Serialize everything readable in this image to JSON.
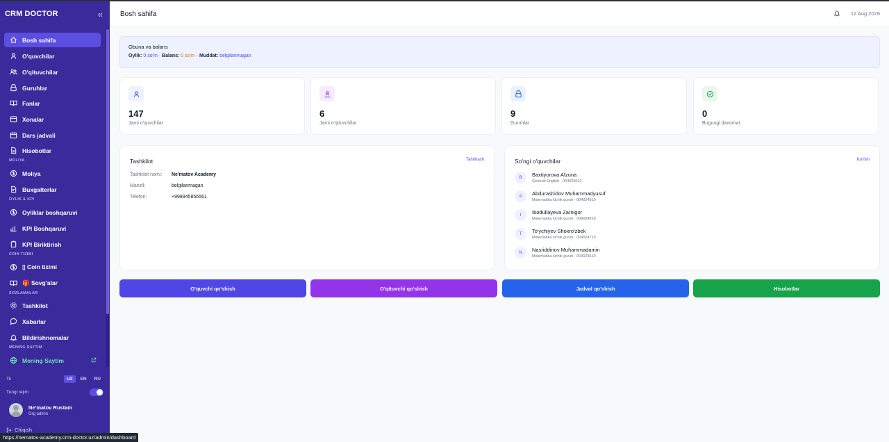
{
  "app": {
    "brand": "CRM DOCTOR"
  },
  "sidebar": {
    "items": [
      {
        "label": "Bosh sahifa",
        "icon": "home-icon"
      },
      {
        "label": "O'quvchilar",
        "icon": "users-icon"
      },
      {
        "label": "O'qituvchilar",
        "icon": "teachers-icon"
      },
      {
        "label": "Guruhlar",
        "icon": "group-icon"
      },
      {
        "label": "Fanlar",
        "icon": "book-icon"
      },
      {
        "label": "Xonalar",
        "icon": "room-icon"
      },
      {
        "label": "Dars jadvali",
        "icon": "calendar-icon"
      },
      {
        "label": "Hisobotlar",
        "icon": "report-icon"
      },
      {
        "label": "Moliya",
        "icon": "dollar-icon"
      },
      {
        "label": "Buxgalterlar",
        "icon": "accountant-icon"
      },
      {
        "label": "Oyliklar boshqaruvi",
        "icon": "dollar-icon"
      },
      {
        "label": "KPI Boshqaruvi",
        "icon": "chart-icon"
      },
      {
        "label": "KPI Biriktirish",
        "icon": "clipboard-icon"
      },
      {
        "label": "▯ Coin tizimi",
        "icon": "coin-icon"
      },
      {
        "label": "🎁 Sovg'alar",
        "icon": "gift-book-icon"
      },
      {
        "label": "Tashkilot",
        "icon": "settings-icon"
      },
      {
        "label": "Xabarlar",
        "icon": "message-icon"
      },
      {
        "label": "Bildirishnomalar",
        "icon": "bell-icon"
      },
      {
        "label": "Mening Saytim",
        "icon": "globe-icon"
      }
    ],
    "sections": [
      "MOLIYA",
      "OYLIK & KPI",
      "COIN TIZIMI",
      "SOZLAMALAR",
      "MENING SAYTIM"
    ],
    "lang_label": "Til",
    "langs": [
      "UZ",
      "EN",
      "RU"
    ],
    "theme_label": "Tungi rejim",
    "user_name": "Ne'matov Rustam",
    "user_role": "Org admin",
    "logout": "Chiqish"
  },
  "header": {
    "title": "Bosh sahifa",
    "date": "12 Aug 2026"
  },
  "subscription": {
    "title": "Obuna va balans",
    "monthly_label": "Oylik:",
    "monthly_value": "0 so'm",
    "sep1": " · ",
    "balance_label": "Balans:",
    "balance_value": "0 so'm",
    "sep2": " · ",
    "term_label": "Muddat:",
    "term_value": "belgilanmagan"
  },
  "stats": [
    {
      "value": "147",
      "label": "Jami o'quvchilar",
      "color": "#4f46e5",
      "bg": "#eef2ff",
      "icon": "users-icon"
    },
    {
      "value": "6",
      "label": "Jami o'qituvchilar",
      "color": "#9333ea",
      "bg": "#f5ecfe",
      "icon": "teachers-icon"
    },
    {
      "value": "9",
      "label": "Guruhlar",
      "color": "#2563eb",
      "bg": "#eaf1fe",
      "icon": "group-icon"
    },
    {
      "value": "0",
      "label": "Bugungi davomat",
      "color": "#16a34a",
      "bg": "#e8f8ee",
      "icon": "check-icon"
    }
  ],
  "org": {
    "title": "Tashkilot",
    "edit": "Tahrirlash",
    "rows": [
      {
        "k": "Tashkilot nomi:",
        "v": "Ne'matov Academy"
      },
      {
        "k": "Manzil:",
        "v": "belgilanmagan"
      },
      {
        "k": "Telefon:",
        "v": "+998945856561"
      }
    ]
  },
  "recent": {
    "title": "So'ngi o'quvchilar",
    "view": "Ko'rish",
    "students": [
      {
        "initial": "B",
        "name": "Baxtiyorova Afzuna",
        "sub": "General English · 004025012"
      },
      {
        "initial": "A",
        "name": "Abdurashidov Muhammadyusuf",
        "sub": "Matematika kichik guruh · 004024919"
      },
      {
        "initial": "I",
        "name": "Ibodullayeva Zarnigor",
        "sub": "Matematika kichik guruh · 004024819"
      },
      {
        "initial": "T",
        "name": "To'ychiyev Shoxro'zbek",
        "sub": "Matematika kichik guruh · 004024719"
      },
      {
        "initial": "N",
        "name": "Nasriddinov Muhammadamin",
        "sub": "Matematika kichik guruh · 004024619"
      }
    ]
  },
  "actions": [
    {
      "label": "O'quvchi qo'shish",
      "color": "#4f46e5"
    },
    {
      "label": "O'qituvchi qo'shish",
      "color": "#9333ea"
    },
    {
      "label": "Jadval qo'shish",
      "color": "#2563eb"
    },
    {
      "label": "Hisobotlar",
      "color": "#16a34a"
    }
  ],
  "status_url": "https://nematov-academy.crm-doctor.uz/admin/dashboard"
}
